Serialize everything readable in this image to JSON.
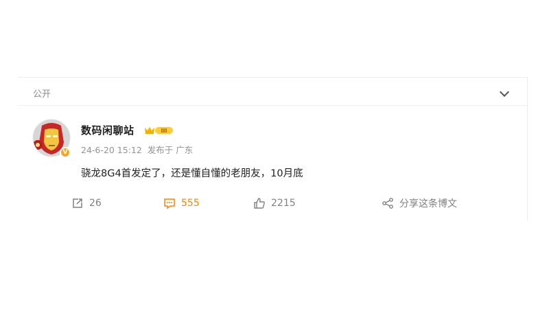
{
  "card": {
    "visibility_label": "公开",
    "author": {
      "name": "数码闲聊站",
      "badge_text": "III",
      "verified_mark": "V"
    },
    "meta": {
      "date": "24-6-20 15:12",
      "published_from": "发布于 广东"
    },
    "content": "骁龙8G4首发定了，还是懂自懂的老朋友，10月底",
    "actions": {
      "repost_count": "26",
      "comment_count": "555",
      "like_count": "2215",
      "share_label": "分享这条博文"
    }
  },
  "colors": {
    "accent_orange": "#ff8200",
    "muted_text": "#939393",
    "verify_badge": "#f5a623"
  },
  "icons": [
    "chevron-down-icon",
    "repost-icon",
    "comment-icon",
    "like-icon",
    "share-icon"
  ]
}
